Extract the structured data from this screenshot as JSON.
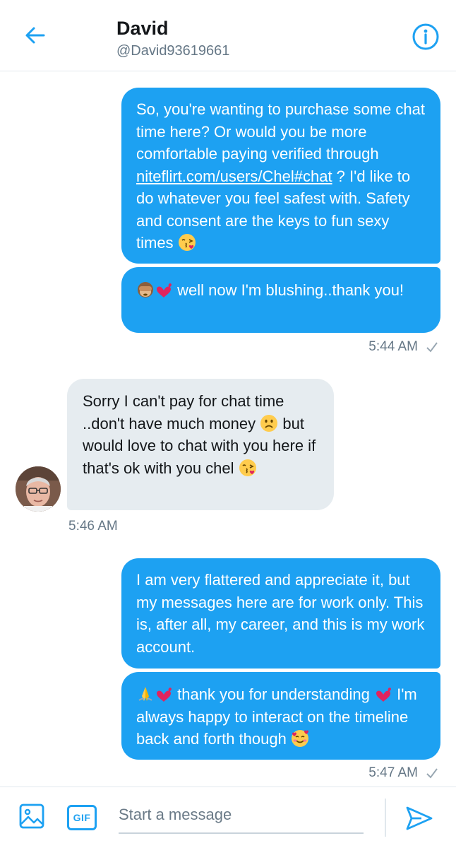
{
  "header": {
    "name": "David",
    "handle": "@David93619661"
  },
  "messages": [
    {
      "id": "s1",
      "text_before_link": "So, you're wanting to purchase some chat time here? Or would you be more comfortable paying verified through ",
      "link": "niteflirt.com/users/Chel#chat",
      "text_after_link": " ? I'd like to do whatever you feel safest with. Safety and consent are the keys to fun sexy times",
      "emoji": "face-blowing-kiss"
    },
    {
      "id": "s2",
      "emojis": [
        "see-no-evil-monkey",
        "two-hearts"
      ],
      "text": " well now I'm blushing..thank you!"
    },
    {
      "id": "r1",
      "text_a": "Sorry I can't pay for chat time ..don't have much money ",
      "emoji_a": "slightly-frowning-face",
      "text_b": " but would love to chat with you here if that's ok with you chel ",
      "emoji_b": "face-blowing-kiss"
    },
    {
      "id": "s3",
      "text": "I am very flattered and appreciate it, but my messages here are for work only. This is, after all, my career, and this is my work account."
    },
    {
      "id": "s4",
      "emojis": [
        "folded-hands",
        "two-hearts"
      ],
      "text_a": " thank you for understanding ",
      "emoji_mid": "two-hearts",
      "text_b": " I'm always happy to interact on the timeline back and forth though ",
      "emoji_end": "smiling-face-with-hearts"
    }
  ],
  "timestamps": {
    "sent_1": "5:44 AM",
    "received_1": "5:46 AM",
    "sent_2": "5:47 AM"
  },
  "composer": {
    "gif_label": "GIF",
    "placeholder": "Start a message"
  },
  "colors": {
    "accent": "#1da1f2",
    "received_bubble": "#e6ecf0",
    "meta_text": "#657786"
  },
  "icons": [
    "back-arrow-icon",
    "info-icon",
    "read-check-icon",
    "image-icon",
    "send-icon"
  ]
}
